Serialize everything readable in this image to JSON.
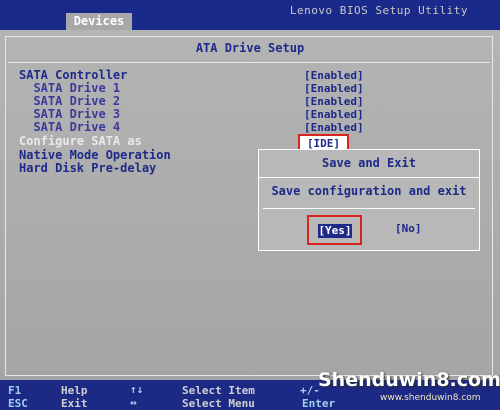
{
  "header": {
    "tab_label": "Devices",
    "app_title": "Lenovo BIOS Setup Utility"
  },
  "panel": {
    "heading": "ATA Drive Setup",
    "rows": [
      {
        "label": "SATA Controller",
        "value": "[Enabled]"
      },
      {
        "label": "  SATA Drive 1",
        "value": "[Enabled]"
      },
      {
        "label": "  SATA Drive 2",
        "value": "[Enabled]"
      },
      {
        "label": "  SATA Drive 3",
        "value": "[Enabled]"
      },
      {
        "label": "  SATA Drive 4",
        "value": "[Enabled]"
      },
      {
        "label": "Configure SATA as",
        "value": "[IDE]"
      },
      {
        "label": "Native Mode Operation",
        "value": ""
      },
      {
        "label": "Hard Disk Pre-delay",
        "value": ""
      }
    ]
  },
  "dialog": {
    "title": "Save and Exit",
    "message": "Save configuration and exit",
    "yes_label": "[Yes]",
    "no_label": "[No]"
  },
  "footer": {
    "f1": "F1",
    "help": "Help",
    "esc": "ESC",
    "exit": "Exit",
    "up_down": "↑↓",
    "left_right": "↔",
    "select_item": "Select Item",
    "select_menu": "Select Menu",
    "plus_minus": "+/-",
    "enter": "Enter"
  },
  "watermark": {
    "text": "Shenduwin8.com",
    "url": "www.shenduwin8.com"
  },
  "colors": {
    "bios_blue": "#1c2a86",
    "panel_gray": "#ababab",
    "highlight_red": "#d8231e"
  }
}
